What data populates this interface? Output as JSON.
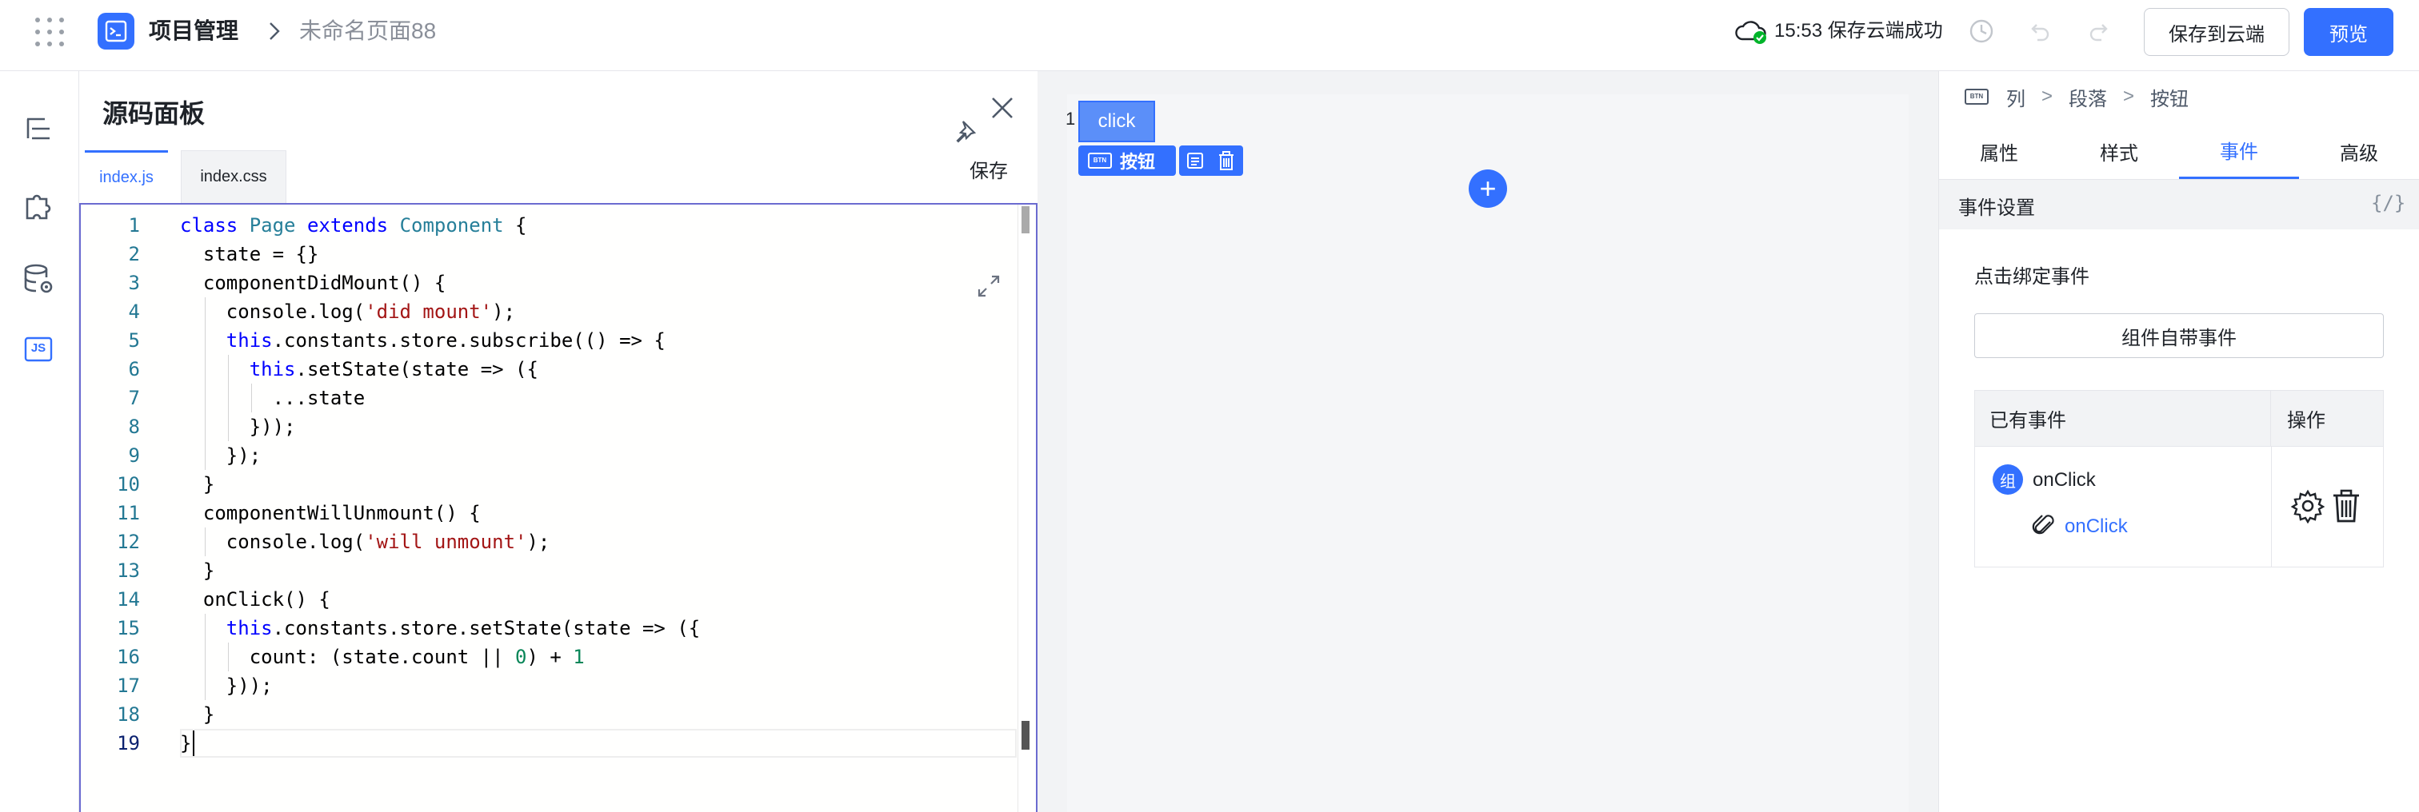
{
  "topbar": {
    "app_title": "项目管理",
    "page_name": "未命名页面88",
    "save_status": "15:53 保存云端成功",
    "save_cloud_label": "保存到云端",
    "preview_label": "预览"
  },
  "rail": {
    "items": [
      "outline-icon",
      "puzzle-icon",
      "database-icon",
      "js-icon"
    ],
    "js_label": "JS"
  },
  "panel": {
    "title": "源码面板",
    "save_label": "保存",
    "tabs": [
      {
        "label": "index.js",
        "active": true
      },
      {
        "label": "index.css",
        "active": false
      }
    ]
  },
  "editor": {
    "line_numbers": [
      "1",
      "2",
      "3",
      "4",
      "5",
      "6",
      "7",
      "8",
      "9",
      "10",
      "11",
      "12",
      "13",
      "14",
      "15",
      "16",
      "17",
      "18",
      "19"
    ],
    "lines": [
      "class Page extends Component {",
      "  state = {}",
      "  componentDidMount() {",
      "    console.log('did mount');",
      "    this.constants.store.subscribe(() => {",
      "      this.setState(state => ({",
      "        ...state",
      "      }));",
      "    });",
      "  }",
      "  componentWillUnmount() {",
      "    console.log('will unmount');",
      "  }",
      "  onClick() {",
      "    this.constants.store.setState(state => ({",
      "      count: (state.count || 0) + 1",
      "    }));",
      "  }",
      "}"
    ],
    "active_line": 19
  },
  "canvas": {
    "row_number": "1",
    "button_text": "click",
    "selection_label": "按钮",
    "selection_badge": "BTN",
    "add_symbol": "+"
  },
  "props": {
    "breadcrumb": [
      "列",
      "段落",
      "按钮"
    ],
    "breadcrumb_badge": "BTN",
    "breadcrumb_sep": ">",
    "tabs": [
      {
        "label": "属性",
        "active": false
      },
      {
        "label": "样式",
        "active": false
      },
      {
        "label": "事件",
        "active": true
      },
      {
        "label": "高级",
        "active": false
      }
    ],
    "event_section_title": "事件设置",
    "code_toggle": "{/}",
    "bind_title": "点击绑定事件",
    "builtin_events_label": "组件自带事件",
    "table": {
      "col_events": "已有事件",
      "col_actions": "操作",
      "row": {
        "badge": "组",
        "event": "onClick",
        "handler": "onClick"
      }
    }
  },
  "colors": {
    "accent": "#3370ff",
    "canvas_bg": "#f2f3f5",
    "editor_border": "#6b6bd0"
  }
}
